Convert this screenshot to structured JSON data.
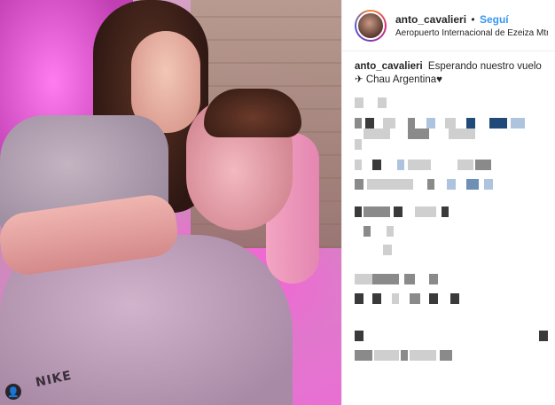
{
  "post": {
    "photo": {
      "shirt_logo": "NIKE"
    },
    "header": {
      "username": "anto_cavalieri",
      "separator": "•",
      "follow_label": "Seguí",
      "location": "Aeropuerto Internacional de Ezeiza Mtro P..."
    },
    "caption": {
      "username": "anto_cavalieri",
      "text": "Esperando nuestro vuelo ✈ Chau Argentina♥"
    },
    "comments": {
      "pixelated": true,
      "colors": {
        "dark": "#3a3a3a",
        "mid": "#8a8a8a",
        "light": "#cfcfcf",
        "blue_dark": "#1f4a7a",
        "blue_mid": "#6f8fb5",
        "blue_light": "#aec3dd"
      }
    }
  }
}
